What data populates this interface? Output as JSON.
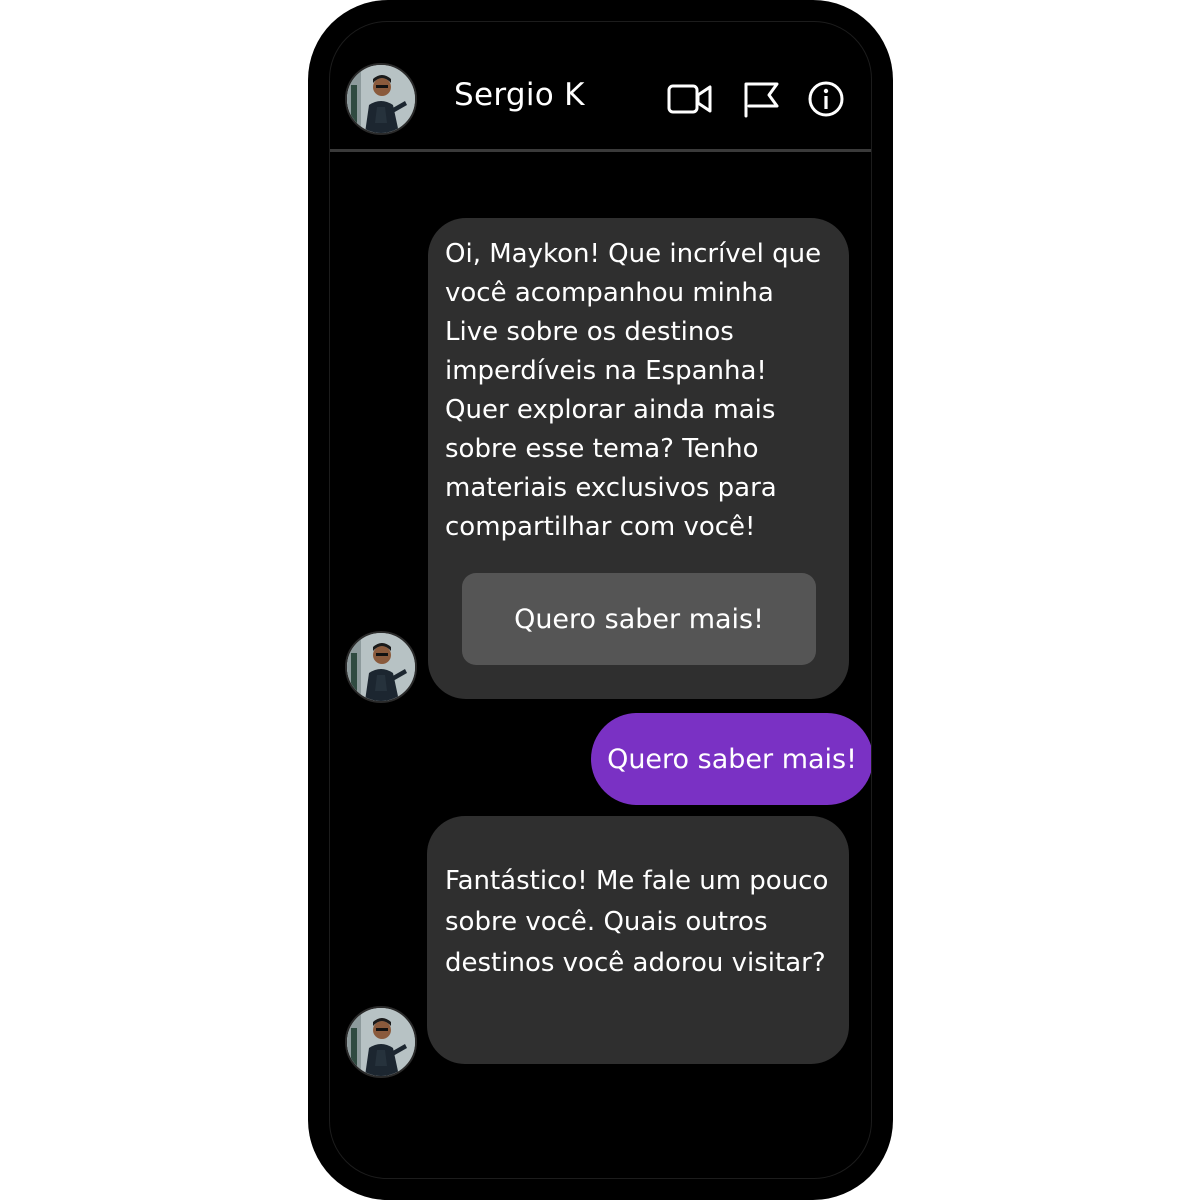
{
  "header": {
    "contact_name": "Sergio K",
    "icons": [
      "video-camera-icon",
      "flag-icon",
      "info-icon"
    ]
  },
  "messages": [
    {
      "from": "contact",
      "text": "Oi, Maykon! Que incrível que você acompanhou minha Live sobre os destinos imperdíveis na Espanha! Quer explorar ainda mais sobre esse tema? Tenho materiais exclusivos para compartilhar com você!",
      "button_label": "Quero saber mais!"
    },
    {
      "from": "user",
      "text": "Quero saber mais!"
    },
    {
      "from": "contact",
      "text": "Fantástico! Me fale um pouco sobre você. Quais outros destinos você adorou visitar?"
    }
  ],
  "colors": {
    "phone_background": "#000000",
    "contact_bubble": "#2f2f2f",
    "user_bubble": "#7a31c4",
    "action_button": "#555555",
    "divider": "#3a3a3a"
  }
}
